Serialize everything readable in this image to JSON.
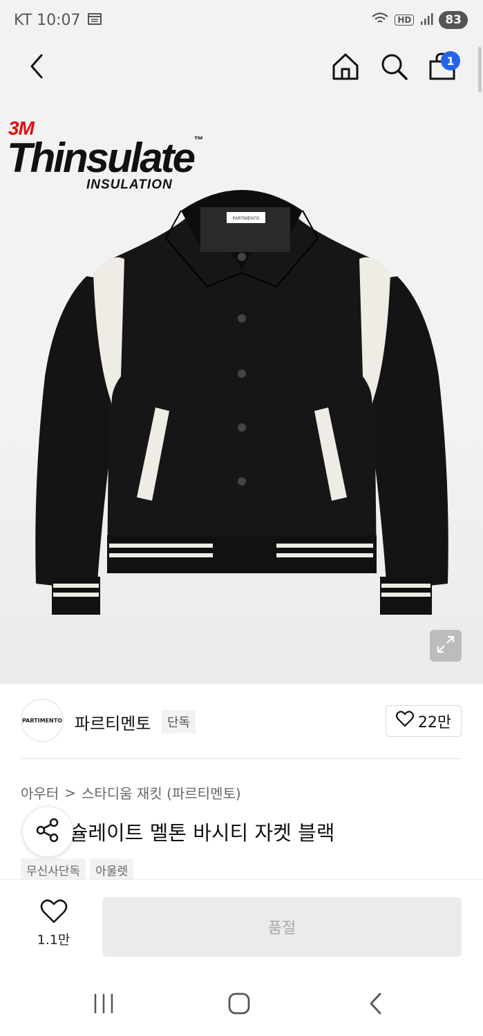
{
  "status_bar": {
    "carrier_time": "KT 10:07",
    "network": "HD",
    "battery": "83"
  },
  "icons": {
    "back": "back-arrow-icon",
    "home": "home-icon",
    "search": "search-icon",
    "cart": "shopping-bag-icon"
  },
  "header": {
    "cart_badge": "1"
  },
  "product_image": {
    "brand_top": "3M",
    "brand_main": "Thinsulate",
    "brand_tm": "™",
    "brand_sub": "INSULATION",
    "label_text": "PARTIMENTO"
  },
  "brand": {
    "logo_text": "PARTIMENTO",
    "name": "파르티멘토",
    "exclusive_tag": "단독",
    "likes": "22만"
  },
  "breadcrumb": {
    "category": "아우터",
    "separator": ">",
    "subcategory": "스타디움 재킷 (파르티멘토)"
  },
  "product": {
    "title": "신슐레이트 멜톤 바시티 자켓 블랙",
    "tags": [
      "무신사단독",
      "아울렛"
    ]
  },
  "bottom_bar": {
    "wish_count": "1.1만",
    "buy_label": "품절"
  },
  "colors": {
    "badge": "#2563eb",
    "brand_3m": "#e20d0d"
  }
}
